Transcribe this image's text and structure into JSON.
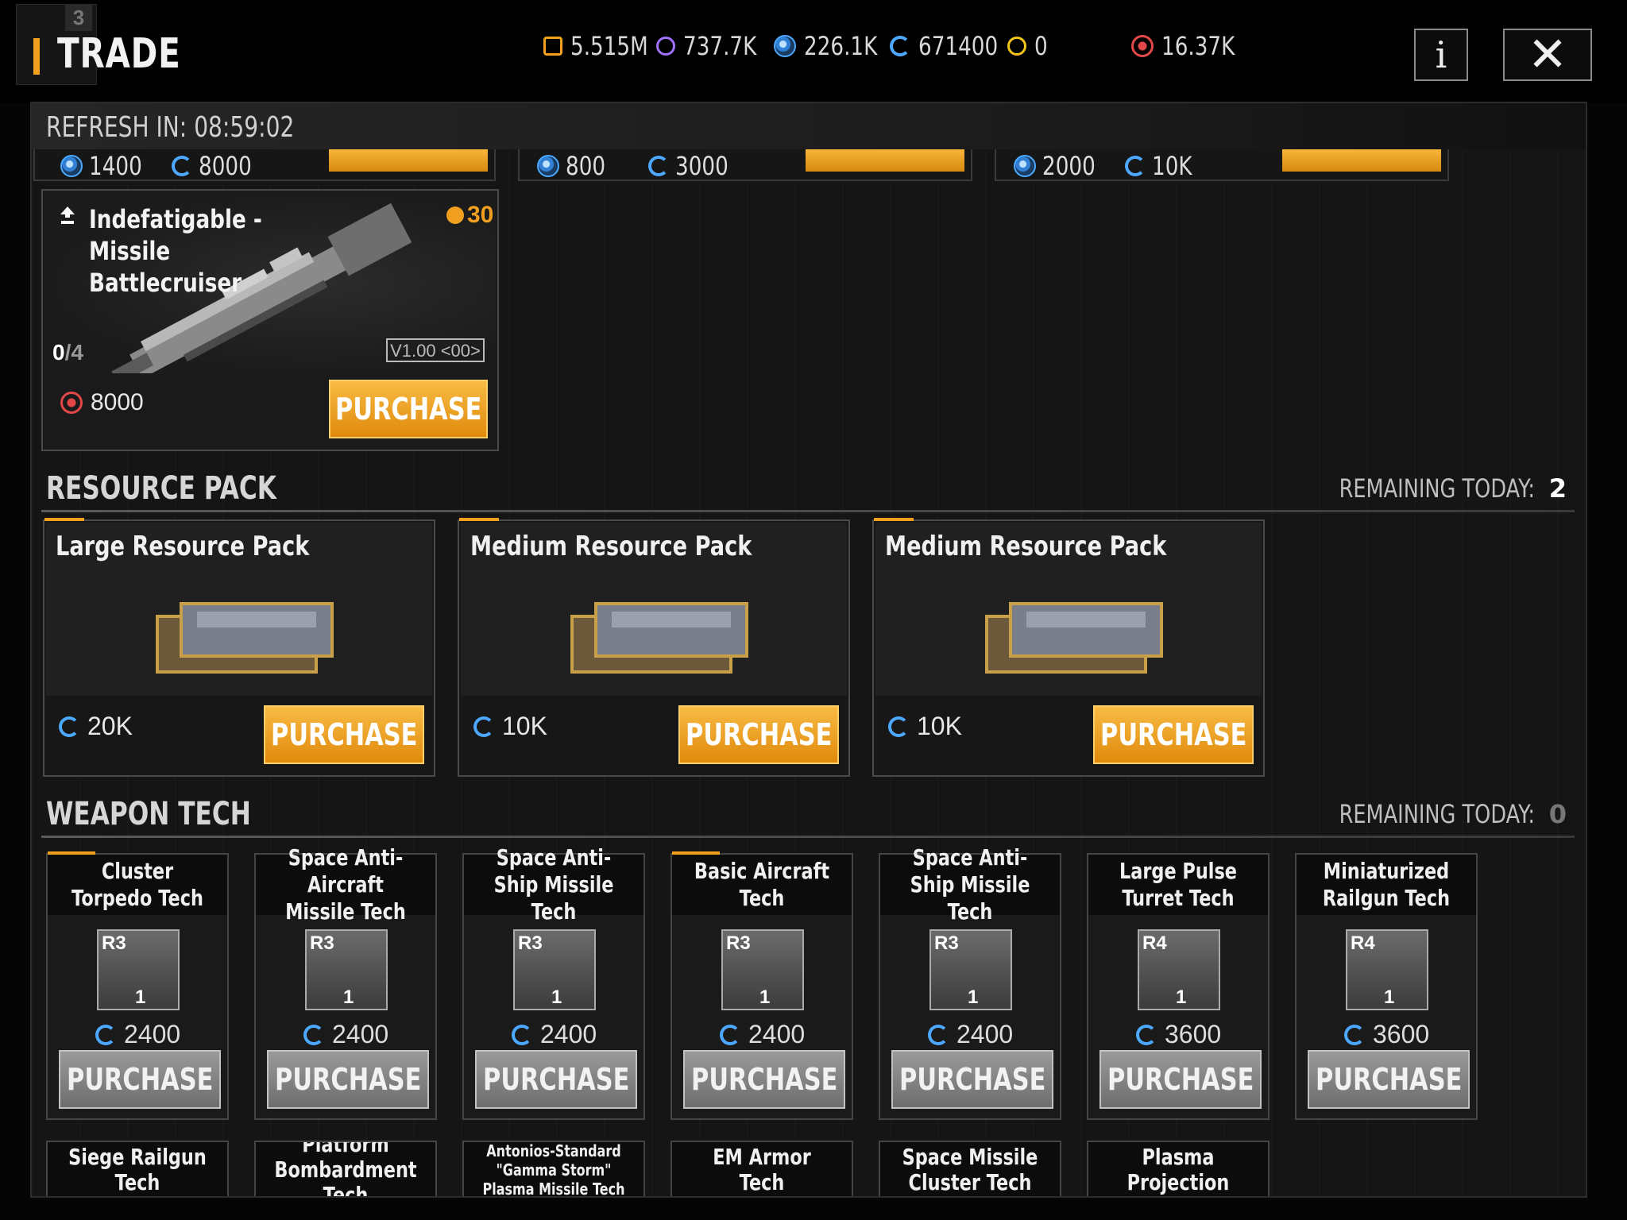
{
  "header": {
    "title": "TRADE",
    "badge": "3",
    "info_label": "i",
    "close_label": "✕"
  },
  "currencies": [
    {
      "icon": "triangle-orange-icon",
      "color": "#f0a01e",
      "value": "5.515M"
    },
    {
      "icon": "crystal-purple-icon",
      "color": "#a070ff",
      "value": "737.7K"
    },
    {
      "icon": "credit-blue-icon",
      "color": "#4da8ff",
      "value": "226.1K"
    },
    {
      "icon": "cycle-blue-icon",
      "color": "#4da8ff",
      "value": "671400"
    },
    {
      "icon": "triangle-yellow-icon",
      "color": "#f5c518",
      "value": "0"
    },
    {
      "icon": "emblem-red-icon",
      "color": "#e24848",
      "value": "16.37K"
    }
  ],
  "refresh": {
    "text": "REFRESH IN: 08:59:02"
  },
  "clipped_row": [
    {
      "credit": "1400",
      "cycle": "8000"
    },
    {
      "credit": "800",
      "cycle": "3000"
    },
    {
      "credit": "2000",
      "cycle": "10K"
    }
  ],
  "ship": {
    "name": "Indefatigable - Missile Battlecruiser",
    "level": "30",
    "owned": "0",
    "max": "/4",
    "version": "V1.00 <00>",
    "price": "8000",
    "purchase_label": "PURCHASE"
  },
  "resource_section": {
    "title": "RESOURCE PACK",
    "remaining_label": "REMAINING TODAY:",
    "remaining_value": "2"
  },
  "resource_packs": [
    {
      "name": "Large Resource Pack",
      "price": "20K",
      "purchase_label": "PURCHASE"
    },
    {
      "name": "Medium Resource Pack",
      "price": "10K",
      "purchase_label": "PURCHASE"
    },
    {
      "name": "Medium Resource Pack",
      "price": "10K",
      "purchase_label": "PURCHASE"
    }
  ],
  "weapon_section": {
    "title": "WEAPON TECH",
    "remaining_label": "REMAINING TODAY:",
    "remaining_value": "0"
  },
  "weapon_techs": [
    {
      "name": "Cluster Torpedo Tech",
      "rank": "R3",
      "qty": "1",
      "price": "2400",
      "purchase_label": "PURCHASE"
    },
    {
      "name": "Space Anti-Aircraft Missile Tech",
      "rank": "R3",
      "qty": "1",
      "price": "2400",
      "purchase_label": "PURCHASE"
    },
    {
      "name": "Space Anti-Ship Missile Tech",
      "rank": "R3",
      "qty": "1",
      "price": "2400",
      "purchase_label": "PURCHASE"
    },
    {
      "name": "Basic Aircraft Tech",
      "rank": "R3",
      "qty": "1",
      "price": "2400",
      "purchase_label": "PURCHASE"
    },
    {
      "name": "Space Anti-Ship Missile Tech",
      "rank": "R3",
      "qty": "1",
      "price": "2400",
      "purchase_label": "PURCHASE"
    },
    {
      "name": "Large Pulse Turret Tech",
      "rank": "R4",
      "qty": "1",
      "price": "3600",
      "purchase_label": "PURCHASE"
    },
    {
      "name": "Miniaturized Railgun Tech",
      "rank": "R4",
      "qty": "1",
      "price": "3600",
      "purchase_label": "PURCHASE"
    }
  ],
  "weapon_techs_row2": [
    {
      "name": "Siege Railgun Tech"
    },
    {
      "name": "Platform Bombardment Tech"
    },
    {
      "name": "Antonios-Standard \"Gamma Storm\" Plasma Missile Tech"
    },
    {
      "name": "EM Armor Tech"
    },
    {
      "name": "Space Missile Cluster Tech"
    },
    {
      "name": "Miniaturized Plasma Projection Tech"
    }
  ]
}
